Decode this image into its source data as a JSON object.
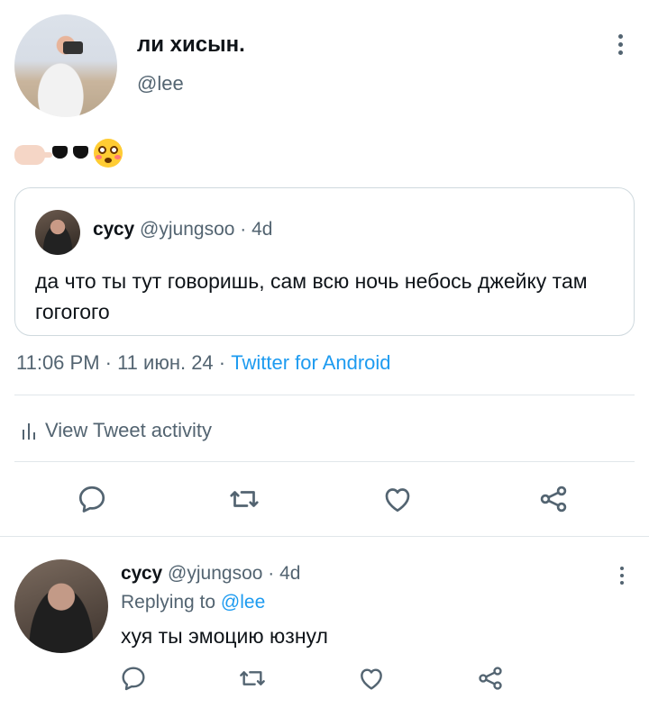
{
  "tweet": {
    "author_name": "ли хисын.",
    "author_handle": "@lee",
    "emoji_text": "🫷🕶😳",
    "timestamp": "11:06 PM · 11 июн. 24 ·",
    "source": "Twitter for Android"
  },
  "quoted_tweet": {
    "author_name": "сусу",
    "author_handle": "@yjungsoo",
    "age": "· 4d",
    "text": "да что ты тут говоришь, сам всю ночь небось джейку там гогогого"
  },
  "activity": {
    "label": "View Tweet activity",
    "icon": "bar-chart-icon"
  },
  "actions": [
    {
      "name": "reply",
      "icon": "reply-icon"
    },
    {
      "name": "retweet",
      "icon": "retweet-icon"
    },
    {
      "name": "like",
      "icon": "like-icon"
    },
    {
      "name": "share",
      "icon": "share-icon"
    }
  ],
  "reply": {
    "author_name": "сусу",
    "author_handle": "@yjungsoo",
    "age": "· 4d",
    "replying_prefix": "Replying to",
    "replying_to": "@lee",
    "text": "хуя ты эмоцию юзнул"
  },
  "colors": {
    "text": "#0f1419",
    "secondary": "#536471",
    "link": "#1d9bf0",
    "border": "#cfd9de"
  }
}
